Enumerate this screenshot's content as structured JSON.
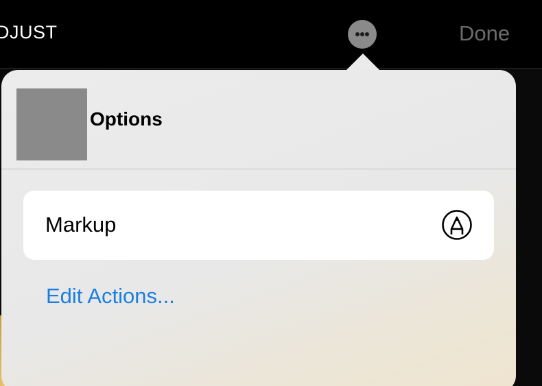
{
  "toolbar": {
    "adjust_label": "DJUST",
    "done_label": "Done",
    "more_icon": "ellipsis-icon"
  },
  "popover": {
    "title": "Options",
    "actions": [
      {
        "label": "Markup",
        "icon": "markup-pen-icon"
      }
    ],
    "edit_actions_label": "Edit Actions..."
  },
  "colors": {
    "link_blue": "#1a7fe0",
    "done_gray": "#6b6b6b",
    "popover_bg": "#ebebeb"
  }
}
